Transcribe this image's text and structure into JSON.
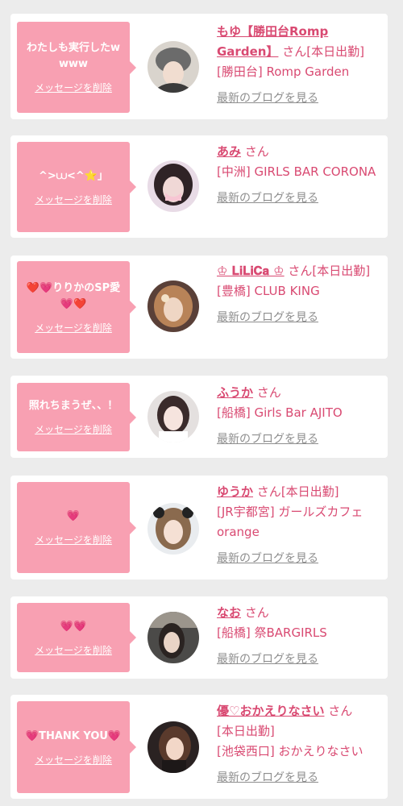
{
  "delete_label": "メッセージを削除",
  "blog_label": "最新のブログを見る",
  "san_label": "さん",
  "colors": {
    "bubble": "#f8a0b2",
    "accent": "#d94a72",
    "blog_link": "#8e8e8e",
    "background": "#ececec"
  },
  "items": [
    {
      "message": "わたしも実行したwwww",
      "name": "もゆ【勝田台Romp Garden】",
      "tag": "[本日出勤]",
      "shop": "[勝田台] Romp Garden"
    },
    {
      "message": "^>⩊<^⭐」",
      "name": "あみ",
      "tag": "",
      "shop": "[中洲] GIRLS BAR CORONA"
    },
    {
      "message": "❤️💗りりかのSP愛💗❤️",
      "name": "♔ 𝐋𝐢𝐋𝐢𝐂𝐚 ♔",
      "tag": "[本日出勤]",
      "shop": "[豊橋] CLUB KING"
    },
    {
      "message": "照れちまうぜ、、！",
      "name": "ふうか",
      "tag": "",
      "shop": "[船橋] Girls Bar AJITO"
    },
    {
      "message": "💗",
      "name": "ゆうか",
      "tag": "[本日出勤]",
      "shop": "[JR宇都宮] ガールズカフェ orange"
    },
    {
      "message": "💗💗",
      "name": "なお",
      "tag": "",
      "shop": "[船橋] 祭BARGIRLS"
    },
    {
      "message": "💗THANK YOU💗",
      "name": "優♡おかえりなさい",
      "tag": "[本日出勤]",
      "shop": "[池袋西口] おかえりなさい"
    }
  ]
}
